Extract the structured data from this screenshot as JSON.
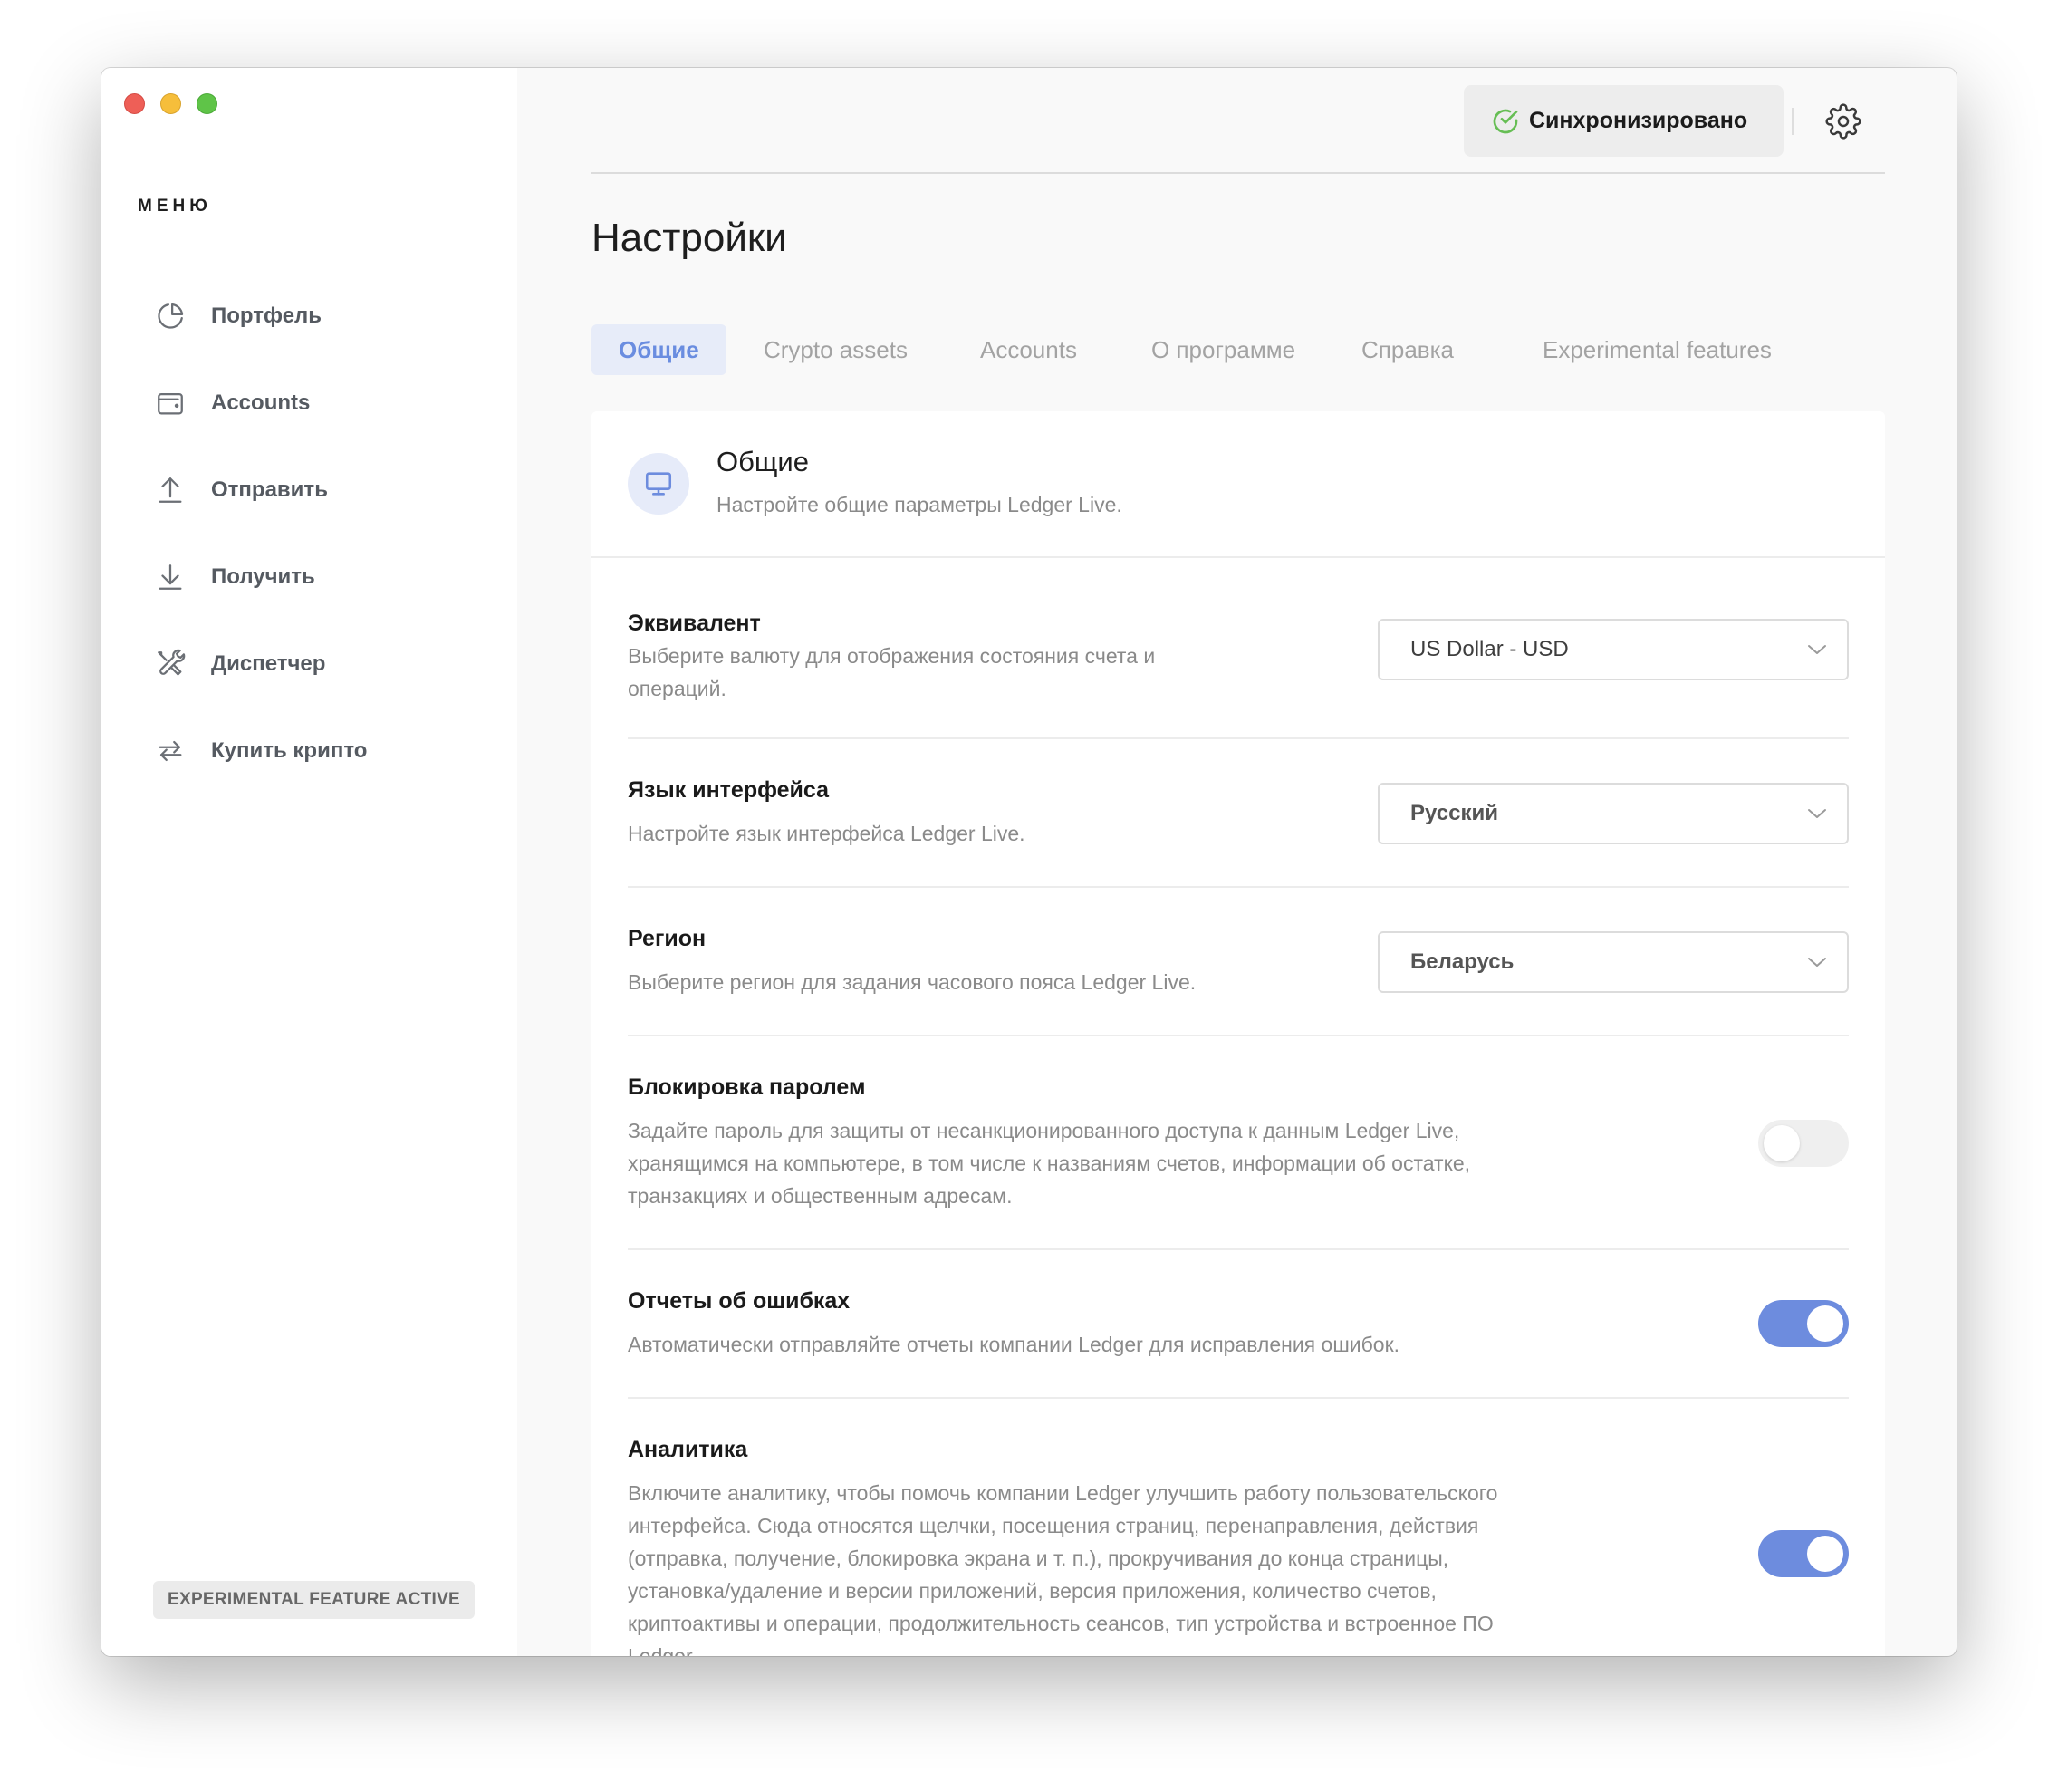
{
  "sidebar": {
    "menu_title": "МЕНЮ",
    "items": [
      {
        "label": "Портфель",
        "icon": "pie-chart-icon"
      },
      {
        "label": "Accounts",
        "icon": "wallet-icon"
      },
      {
        "label": "Отправить",
        "icon": "arrow-up-icon"
      },
      {
        "label": "Получить",
        "icon": "arrow-down-icon"
      },
      {
        "label": "Диспетчер",
        "icon": "tools-icon"
      },
      {
        "label": "Купить крипто",
        "icon": "exchange-icon"
      }
    ],
    "badge": "EXPERIMENTAL FEATURE ACTIVE"
  },
  "topbar": {
    "sync_label": "Синхронизировано",
    "sync_icon": "check-circle-icon",
    "settings_icon": "gear-icon"
  },
  "page": {
    "title": "Настройки"
  },
  "tabs": [
    {
      "label": "Общие",
      "active": true
    },
    {
      "label": "Crypto assets",
      "active": false
    },
    {
      "label": "Accounts",
      "active": false
    },
    {
      "label": "О программе",
      "active": false
    },
    {
      "label": "Справка",
      "active": false
    },
    {
      "label": "Experimental features",
      "active": false
    }
  ],
  "section": {
    "title": "Общие",
    "description": "Настройте общие параметры Ledger Live.",
    "icon": "monitor-icon"
  },
  "settings": {
    "currency": {
      "title": "Эквивалент",
      "description": "Выберите валюту для отображения состояния счета и операций.",
      "value": "US Dollar - USD"
    },
    "language": {
      "title": "Язык интерфейса",
      "description": "Настройте язык интерфейса Ledger Live.",
      "value": "Русский"
    },
    "region": {
      "title": "Регион",
      "description": "Выберите регион для задания часового пояса Ledger Live.",
      "value": "Беларусь"
    },
    "password_lock": {
      "title": "Блокировка паролем",
      "description": "Задайте пароль для защиты от несанкционированного доступа к данным Ledger Live, хранящимся на компьютере, в том числе к названиям счетов, информации об остатке, транзакциях и общественным адресам.",
      "enabled": false
    },
    "error_reports": {
      "title": "Отчеты об ошибках",
      "description": "Автоматически отправляйте отчеты компании Ledger для исправления ошибок.",
      "enabled": true
    },
    "analytics": {
      "title": "Аналитика",
      "description": "Включите аналитику, чтобы помочь компании Ledger улучшить работу пользовательского интерфейса. Сюда относятся щелчки, посещения страниц, перенаправления, действия (отправка, получение, блокировка экрана и т. п.), прокручивания до конца страницы, установка/удаление и версии приложений, версия приложения, количество счетов, криптоактивы и операции, продолжительность сеансов, тип устройства и встроенное ПО Ledger.",
      "enabled": true
    }
  },
  "colors": {
    "accent": "#6d8cde",
    "sync_check": "#66be54"
  }
}
